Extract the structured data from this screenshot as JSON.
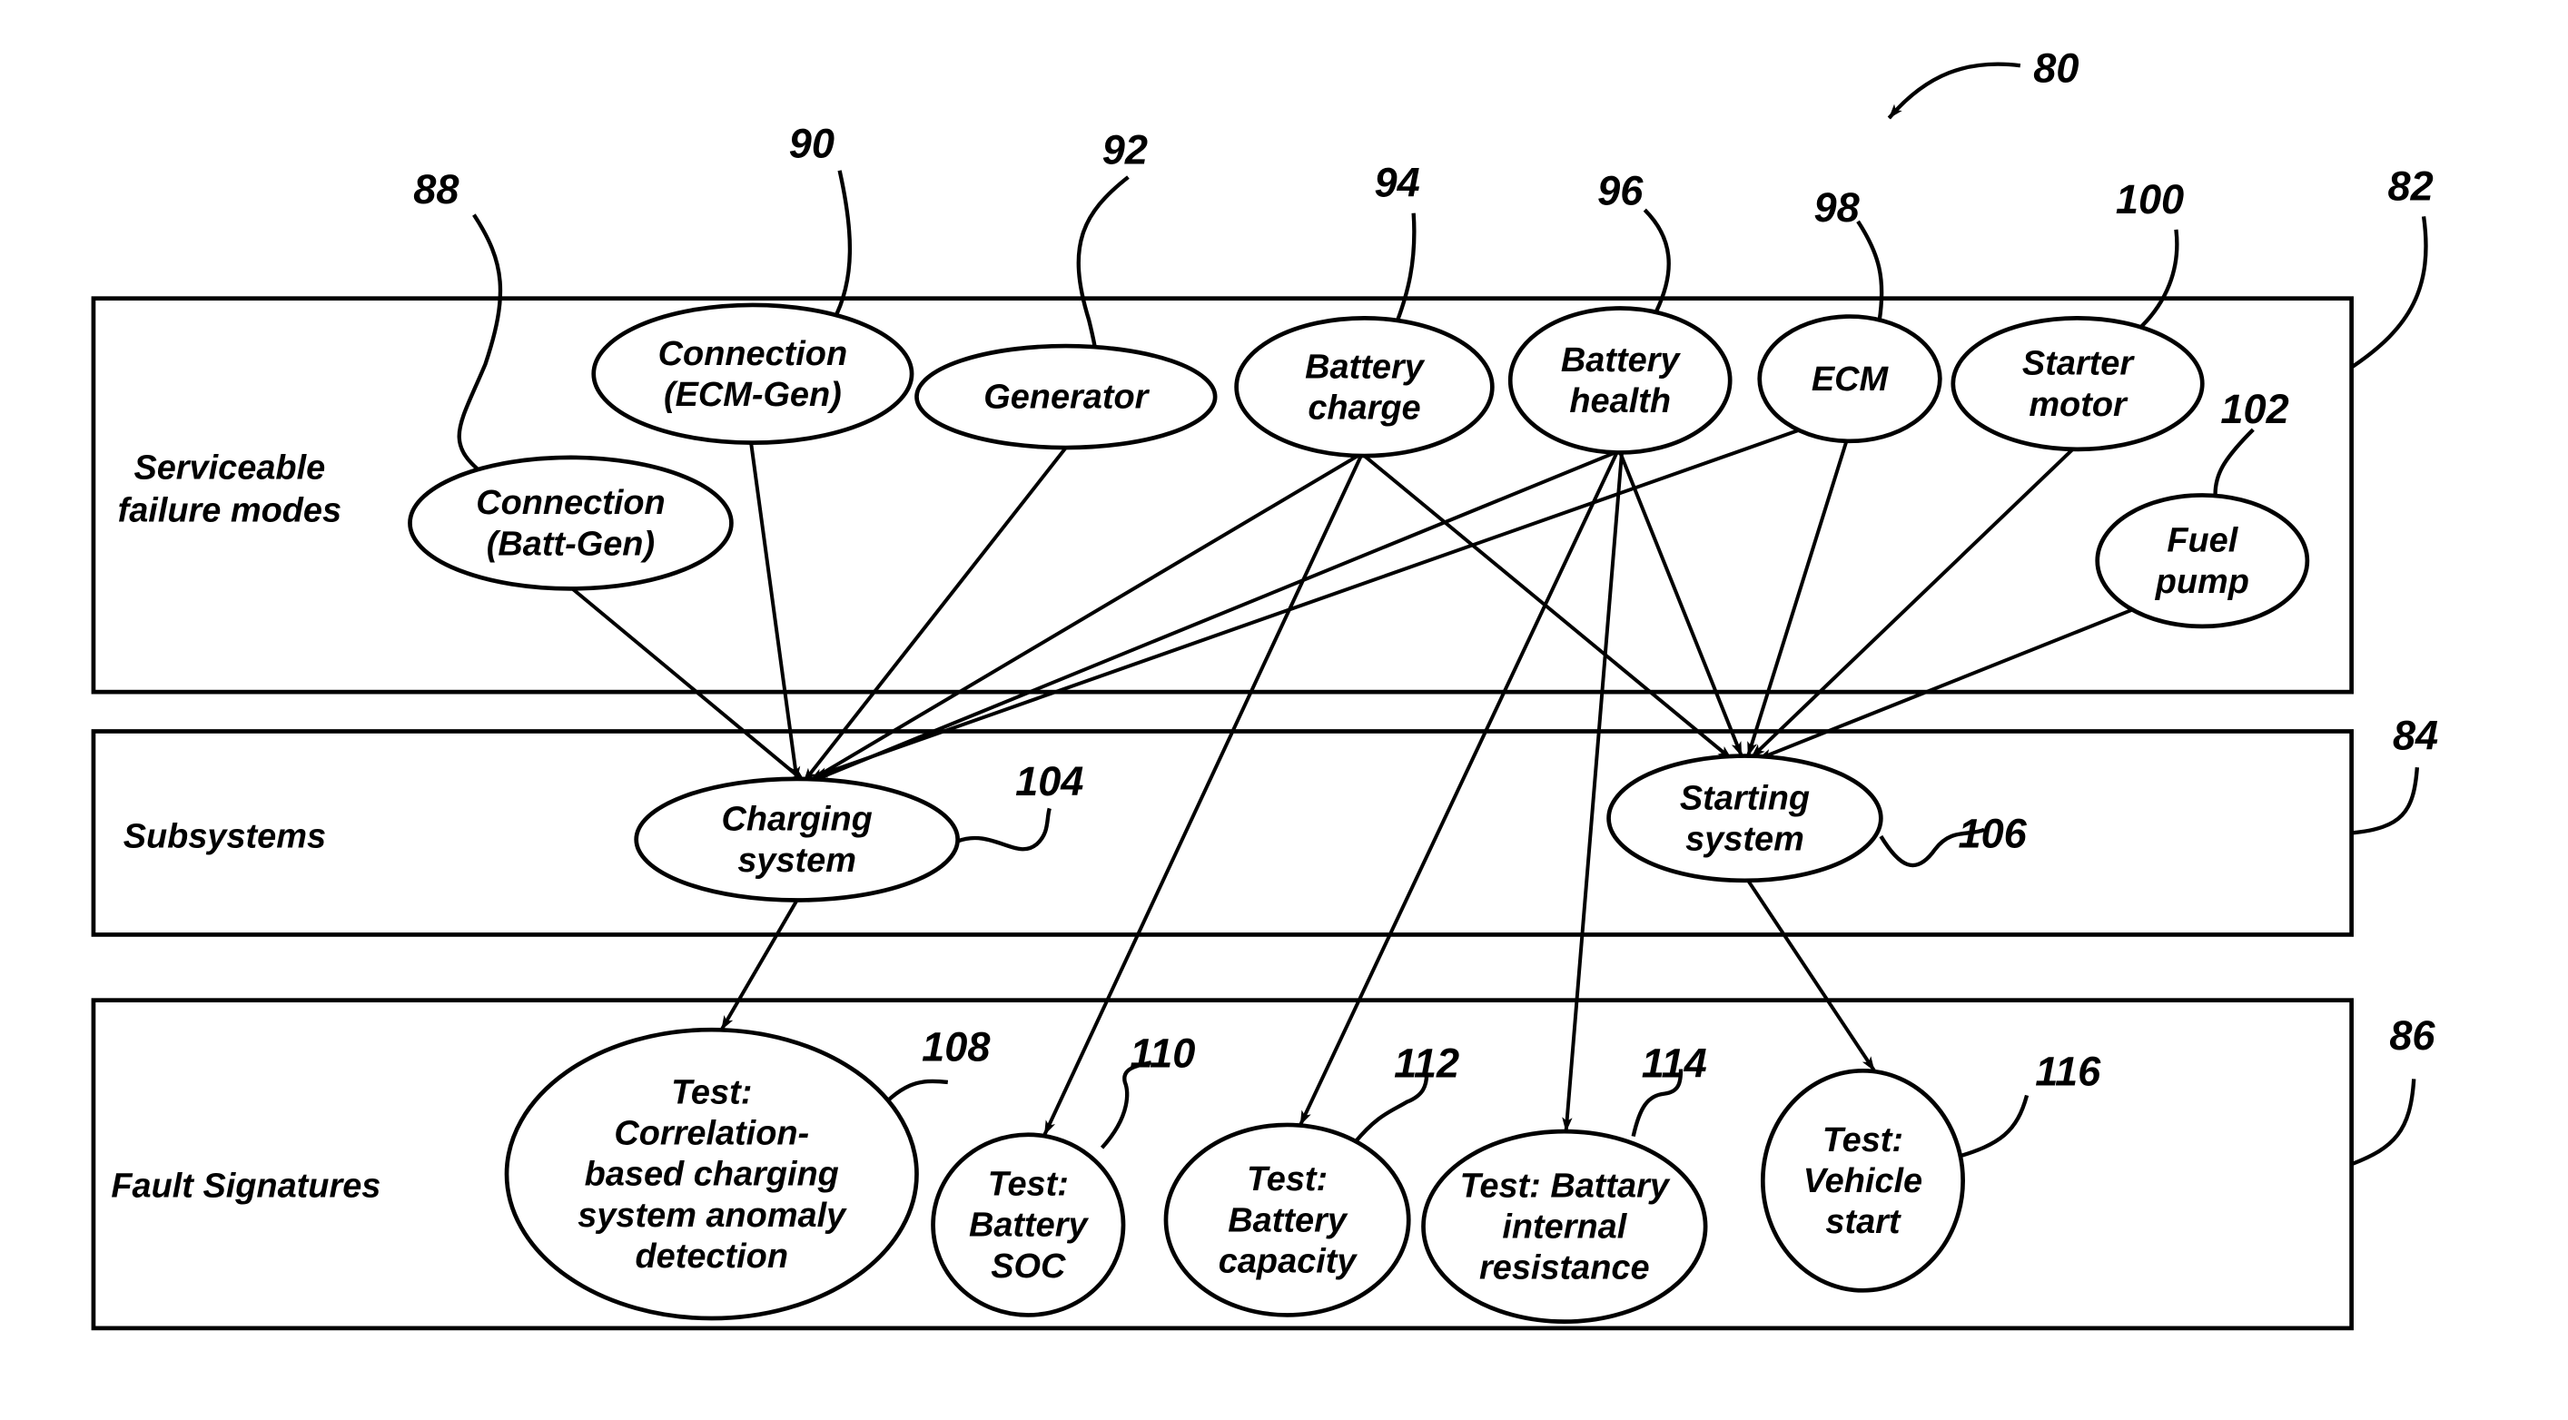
{
  "figure": {
    "ref": "80",
    "layers": [
      {
        "id": "serviceable",
        "ref": "82",
        "label_lines": [
          "Serviceable",
          "failure modes"
        ]
      },
      {
        "id": "subsystems",
        "ref": "84",
        "label_lines": [
          "Subsystems"
        ]
      },
      {
        "id": "fault",
        "ref": "86",
        "label_lines": [
          "Fault Signatures"
        ]
      }
    ],
    "nodes": [
      {
        "id": "conn_batt_gen",
        "ref": "88",
        "layer": "serviceable",
        "lines": [
          "Connection",
          "(Batt-Gen)"
        ]
      },
      {
        "id": "conn_ecm_gen",
        "ref": "90",
        "layer": "serviceable",
        "lines": [
          "Connection",
          "(ECM-Gen)"
        ]
      },
      {
        "id": "generator",
        "ref": "92",
        "layer": "serviceable",
        "lines": [
          "Generator"
        ]
      },
      {
        "id": "battery_charge",
        "ref": "94",
        "layer": "serviceable",
        "lines": [
          "Battery",
          "charge"
        ]
      },
      {
        "id": "battery_health",
        "ref": "96",
        "layer": "serviceable",
        "lines": [
          "Battery",
          "health"
        ]
      },
      {
        "id": "ecm",
        "ref": "98",
        "layer": "serviceable",
        "lines": [
          "ECM"
        ]
      },
      {
        "id": "starter_motor",
        "ref": "100",
        "layer": "serviceable",
        "lines": [
          "Starter",
          "motor"
        ]
      },
      {
        "id": "fuel_pump",
        "ref": "102",
        "layer": "serviceable",
        "lines": [
          "Fuel",
          "pump"
        ]
      },
      {
        "id": "charging_system",
        "ref": "104",
        "layer": "subsystems",
        "lines": [
          "Charging",
          "system"
        ]
      },
      {
        "id": "starting_system",
        "ref": "106",
        "layer": "subsystems",
        "lines": [
          "Starting",
          "system"
        ]
      },
      {
        "id": "test_correlation",
        "ref": "108",
        "layer": "fault",
        "lines": [
          "Test:",
          "Correlation-",
          "based charging",
          "system anomaly",
          "detection"
        ]
      },
      {
        "id": "test_soc",
        "ref": "110",
        "layer": "fault",
        "lines": [
          "Test:",
          "Battery",
          "SOC"
        ]
      },
      {
        "id": "test_capacity",
        "ref": "112",
        "layer": "fault",
        "lines": [
          "Test:",
          "Battery",
          "capacity"
        ]
      },
      {
        "id": "test_resistance",
        "ref": "114",
        "layer": "fault",
        "lines": [
          "Test: Battary",
          "internal",
          "resistance"
        ]
      },
      {
        "id": "test_vehicle_start",
        "ref": "116",
        "layer": "fault",
        "lines": [
          "Test:",
          "Vehicle",
          "start"
        ]
      }
    ],
    "edges": [
      {
        "from": "conn_batt_gen",
        "to": "charging_system"
      },
      {
        "from": "conn_ecm_gen",
        "to": "charging_system"
      },
      {
        "from": "generator",
        "to": "charging_system"
      },
      {
        "from": "battery_charge",
        "to": "charging_system"
      },
      {
        "from": "battery_health",
        "to": "charging_system"
      },
      {
        "from": "ecm",
        "to": "charging_system"
      },
      {
        "from": "battery_charge",
        "to": "starting_system"
      },
      {
        "from": "battery_health",
        "to": "starting_system"
      },
      {
        "from": "ecm",
        "to": "starting_system"
      },
      {
        "from": "starter_motor",
        "to": "starting_system"
      },
      {
        "from": "fuel_pump",
        "to": "starting_system"
      },
      {
        "from": "battery_charge",
        "to": "test_soc"
      },
      {
        "from": "battery_health",
        "to": "test_capacity"
      },
      {
        "from": "battery_health",
        "to": "test_resistance"
      },
      {
        "from": "charging_system",
        "to": "test_correlation"
      },
      {
        "from": "starting_system",
        "to": "test_vehicle_start"
      }
    ]
  }
}
